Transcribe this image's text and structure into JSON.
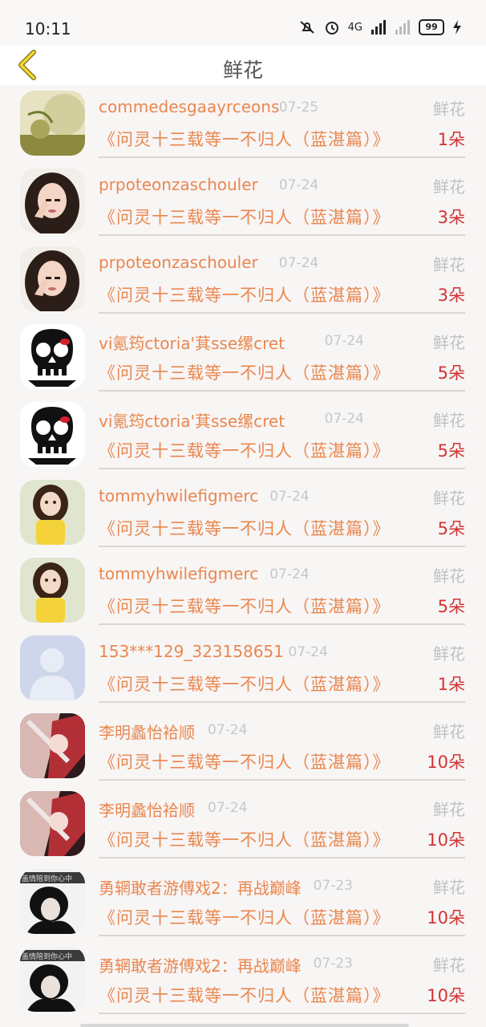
{
  "status_bar": {
    "time": "10:11",
    "network": "4G",
    "battery": "99"
  },
  "header": {
    "back_icon": "chevron-left-icon",
    "title": "鲜花"
  },
  "colors": {
    "name": "#e9874f",
    "qty": "#d43434",
    "muted": "#c0c0c0"
  },
  "rows": [
    {
      "name": "commedesgaayrceons",
      "date": "07-25",
      "type": "鲜花",
      "book": "《问灵十三载等一不归人（蓝湛篇）》",
      "qty": "1朵",
      "avatar": "plant"
    },
    {
      "name": "prpoteonzaschouler",
      "date": "07-24",
      "type": "鲜花",
      "book": "《问灵十三载等一不归人（蓝湛篇）》",
      "qty": "3朵",
      "avatar": "girl"
    },
    {
      "name": "prpoteonzaschouler",
      "date": "07-24",
      "type": "鲜花",
      "book": "《问灵十三载等一不归人（蓝湛篇）》",
      "qty": "3朵",
      "avatar": "girl"
    },
    {
      "name": "vi氪筠ctoria'萁sse缧cret",
      "date": "07-24",
      "type": "鲜花",
      "book": "《问灵十三载等一不归人（蓝湛篇）》",
      "qty": "5朵",
      "avatar": "skull"
    },
    {
      "name": "vi氪筠ctoria'萁sse缧cret",
      "date": "07-24",
      "type": "鲜花",
      "book": "《问灵十三载等一不归人（蓝湛篇）》",
      "qty": "5朵",
      "avatar": "skull"
    },
    {
      "name": "tommyhwilefigmerc",
      "date": "07-24",
      "type": "鲜花",
      "book": "《问灵十三载等一不归人（蓝湛篇）》",
      "qty": "5朵",
      "avatar": "child"
    },
    {
      "name": "tommyhwilefigmerc",
      "date": "07-24",
      "type": "鲜花",
      "book": "《问灵十三载等一不归人（蓝湛篇）》",
      "qty": "5朵",
      "avatar": "child"
    },
    {
      "name": "153***129_323158651",
      "date": "07-24",
      "type": "鲜花",
      "book": "《问灵十三载等一不归人（蓝湛篇）》",
      "qty": "1朵",
      "avatar": "default"
    },
    {
      "name": "李明蠡怡袷顺",
      "date": "07-24",
      "type": "鲜花",
      "book": "《问灵十三载等一不归人（蓝湛篇）》",
      "qty": "10朵",
      "avatar": "anime"
    },
    {
      "name": "李明蠡怡袷顺",
      "date": "07-24",
      "type": "鲜花",
      "book": "《问灵十三载等一不归人（蓝湛篇）》",
      "qty": "10朵",
      "avatar": "anime"
    },
    {
      "name": "勇辋敢者游傅戏2：再战巅峰",
      "date": "07-23",
      "type": "鲜花",
      "book": "《问灵十三载等一不归人（蓝湛篇）》",
      "qty": "10朵",
      "avatar": "dark"
    },
    {
      "name": "勇辋敢者游傅戏2：再战巅峰",
      "date": "07-23",
      "type": "鲜花",
      "book": "《问灵十三载等一不归人（蓝湛篇）》",
      "qty": "10朵",
      "avatar": "dark"
    }
  ]
}
